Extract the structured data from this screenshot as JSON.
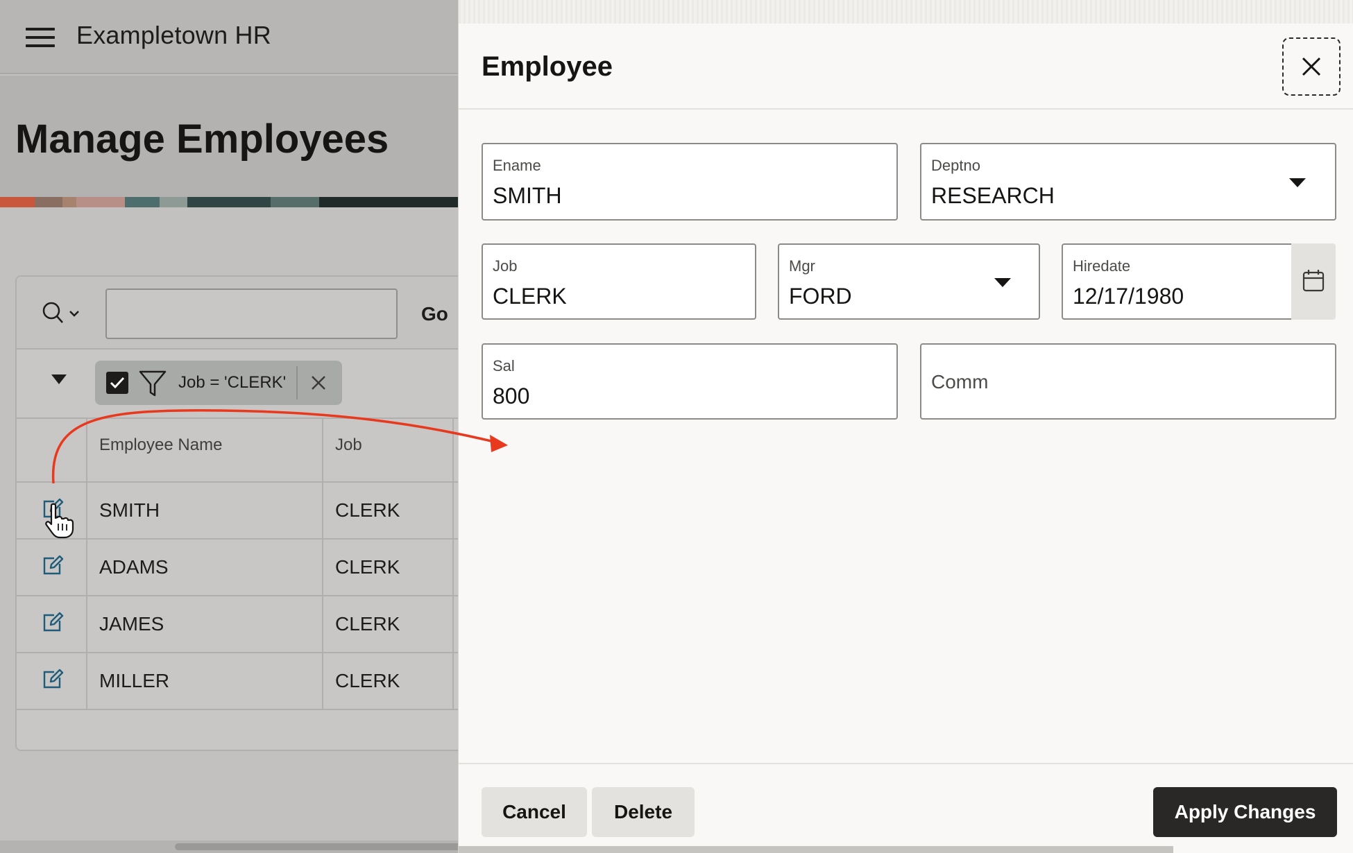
{
  "app": {
    "title": "Exampletown HR",
    "page_title": "Manage Employees"
  },
  "report": {
    "search_placeholder": "",
    "go_label": "Go",
    "filter_label": "Job = 'CLERK'",
    "columns": [
      "Employee Name",
      "Job"
    ],
    "rows": [
      {
        "name": "SMITH",
        "job": "CLERK"
      },
      {
        "name": "ADAMS",
        "job": "CLERK"
      },
      {
        "name": "JAMES",
        "job": "CLERK"
      },
      {
        "name": "MILLER",
        "job": "CLERK"
      }
    ]
  },
  "dialog": {
    "title": "Employee",
    "fields": {
      "ename": {
        "label": "Ename",
        "value": "SMITH"
      },
      "deptno": {
        "label": "Deptno",
        "value": "RESEARCH"
      },
      "job": {
        "label": "Job",
        "value": "CLERK"
      },
      "mgr": {
        "label": "Mgr",
        "value": "FORD"
      },
      "hiredate": {
        "label": "Hiredate",
        "value": "12/17/1980"
      },
      "sal": {
        "label": "Sal",
        "value": "800"
      },
      "comm": {
        "label": "Comm",
        "value": ""
      }
    },
    "buttons": {
      "cancel": "Cancel",
      "delete": "Delete",
      "apply": "Apply Changes"
    }
  },
  "colors": {
    "annotation_arrow": "#e8381e",
    "apply_button": "#2a2826",
    "edit_icon": "#1f5c7a"
  },
  "icons": [
    "hamburger-icon",
    "search-icon",
    "chevron-down-icon",
    "checkbox-icon",
    "funnel-icon",
    "close-icon",
    "edit-icon",
    "calendar-icon",
    "dropdown-arrow-icon",
    "pointer-cursor-icon"
  ]
}
